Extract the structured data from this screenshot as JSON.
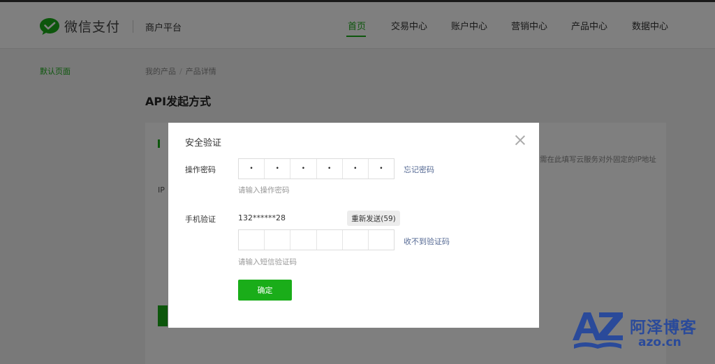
{
  "header": {
    "brand": "微信支付",
    "platform": "商户平台",
    "nav": [
      {
        "label": "首页",
        "active": true
      },
      {
        "label": "交易中心",
        "active": false
      },
      {
        "label": "账户中心",
        "active": false
      },
      {
        "label": "营销中心",
        "active": false
      },
      {
        "label": "产品中心",
        "active": false
      },
      {
        "label": "数据中心",
        "active": false
      }
    ]
  },
  "sidebar": {
    "link": "默认页面"
  },
  "breadcrumb": {
    "item1": "我的产品",
    "separator": "/",
    "item2": "产品详情"
  },
  "page": {
    "title": "API发起方式",
    "card_hint": "需在此填写云服务对外固定的IP地址",
    "card_ip_label": "IP"
  },
  "modal": {
    "title": "安全验证",
    "password": {
      "label": "操作密码",
      "cells": [
        "•",
        "•",
        "•",
        "•",
        "•",
        "•"
      ],
      "forgot_link": "忘记密码",
      "hint": "请输入操作密码"
    },
    "sms": {
      "label": "手机验证",
      "phone": "132******28",
      "resend_button": "重新发送(59)",
      "cells": [
        "",
        "",
        "",
        "",
        "",
        ""
      ],
      "not_received_link": "收不到验证码",
      "hint": "请输入短信验证码"
    },
    "confirm_button": "确定",
    "close_icon": "close-icon"
  },
  "watermark": {
    "name": "阿泽博客",
    "url": "azo.cn"
  },
  "colors": {
    "brand_green": "#1aad19",
    "link_blue": "#576b95",
    "watermark_blue": "#2a4a9a"
  }
}
